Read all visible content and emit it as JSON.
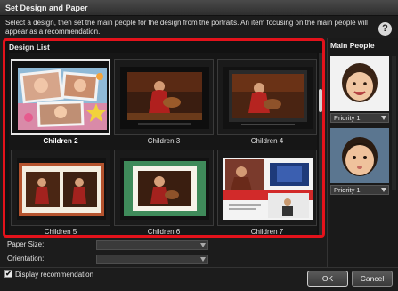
{
  "window": {
    "title": "Set Design and Paper"
  },
  "instructions": "Select a design, then set the main people for the design from the portraits. An item focusing on the main people will appear as a recommendation.",
  "design_list": {
    "title": "Design List",
    "items": [
      {
        "label": "Children 2",
        "selected": true
      },
      {
        "label": "Children 3",
        "selected": false
      },
      {
        "label": "Children 4",
        "selected": false
      },
      {
        "label": "Children 5",
        "selected": false
      },
      {
        "label": "Children 6",
        "selected": false
      },
      {
        "label": "Children 7",
        "selected": false
      }
    ]
  },
  "main_people": {
    "title": "Main People",
    "people": [
      {
        "priority": "Priority 1"
      },
      {
        "priority": "Priority 1"
      }
    ]
  },
  "paper": {
    "size_label": "Paper Size:",
    "size_value": "",
    "orientation_label": "Orientation:",
    "orientation_value": ""
  },
  "display_recommendation": {
    "label": "Display recommendation",
    "checked": true,
    "check_mark": "✔"
  },
  "buttons": {
    "ok": "OK",
    "cancel": "Cancel"
  },
  "help_icon": {
    "glyph": "?"
  },
  "colors": {
    "highlight_border": "#e3121b",
    "background": "#1c1c1c"
  }
}
